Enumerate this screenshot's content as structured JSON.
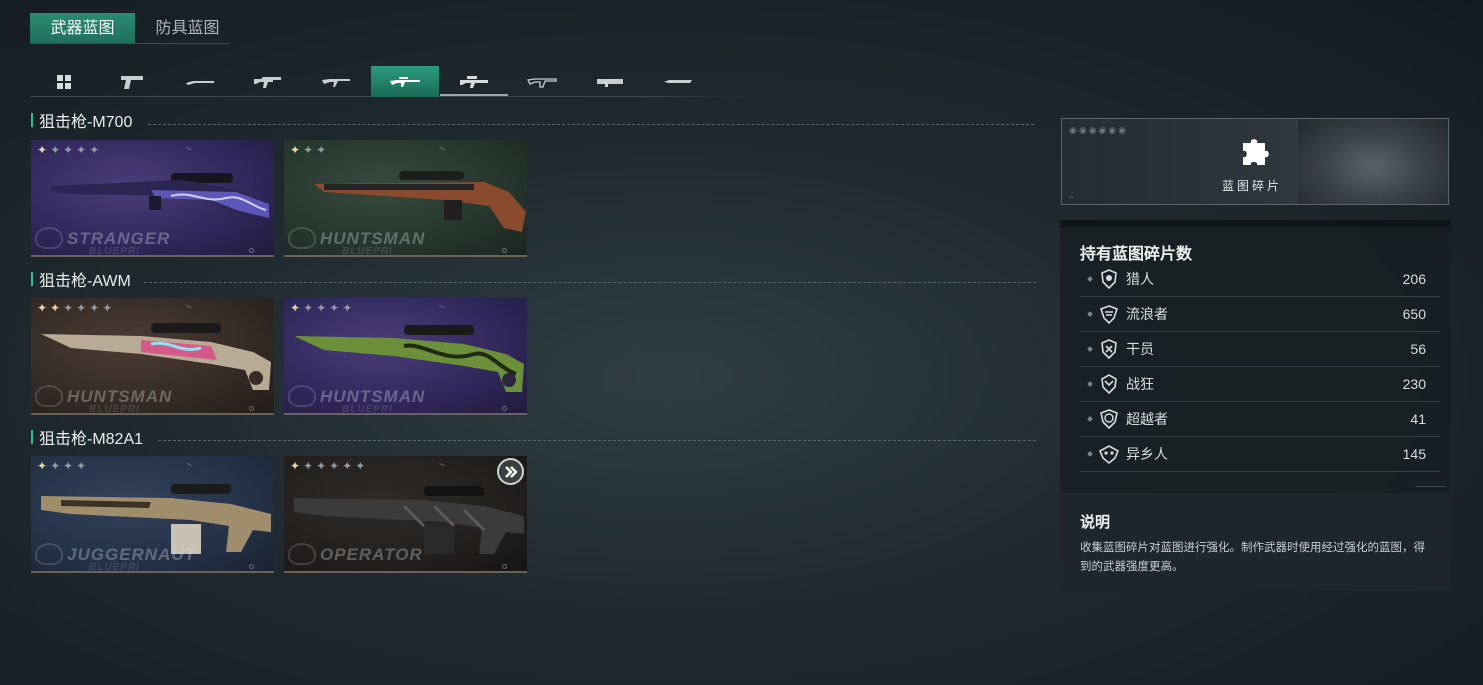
{
  "top_tabs": [
    {
      "label": "武器蓝图",
      "active": true
    },
    {
      "label": "防具蓝图",
      "active": false
    }
  ],
  "categories": [
    {
      "icon": "grid-icon",
      "active": false
    },
    {
      "icon": "pistol-icon",
      "active": false
    },
    {
      "icon": "shotgun-icon",
      "active": false
    },
    {
      "icon": "smg-icon",
      "active": false
    },
    {
      "icon": "assault-rifle-icon",
      "active": false
    },
    {
      "icon": "sniper-rifle-icon",
      "active": true
    },
    {
      "icon": "dmr-icon",
      "active": false
    },
    {
      "icon": "lmg-icon",
      "active": false
    },
    {
      "icon": "launcher-icon",
      "active": false
    },
    {
      "icon": "melee-icon",
      "active": false
    }
  ],
  "sections": [
    {
      "title": "狙击枪-M700",
      "cards": [
        {
          "brand": "STRANGER",
          "brand_sub": "BLUEPRI",
          "stars_lit": 1,
          "stars_total": 5,
          "theme": "purple",
          "locked": false
        },
        {
          "brand": "HUNTSMAN",
          "brand_sub": "BLUEPRI",
          "stars_lit": 1,
          "stars_total": 3,
          "theme": "green",
          "locked": false
        }
      ]
    },
    {
      "title": "狙击枪-AWM",
      "cards": [
        {
          "brand": "HUNTSMAN",
          "brand_sub": "BLUEPRI",
          "stars_lit": 2,
          "stars_total": 6,
          "theme": "brown",
          "locked": false
        },
        {
          "brand": "HUNTSMAN",
          "brand_sub": "BLUEPRI",
          "stars_lit": 1,
          "stars_total": 5,
          "theme": "purple",
          "locked": false
        }
      ]
    },
    {
      "title": "狙击枪-M82A1",
      "cards": [
        {
          "brand": "JUGGERNAUT",
          "brand_sub": "BLUEPRI",
          "stars_lit": 1,
          "stars_total": 4,
          "theme": "blue",
          "locked": false
        },
        {
          "brand": "OPERATOR",
          "brand_sub": "",
          "stars_lit": 1,
          "stars_total": 6,
          "theme": "dark",
          "locked": true
        }
      ]
    }
  ],
  "fragment_banner": {
    "label": "蓝图碎片",
    "icon": "puzzle-piece-icon"
  },
  "holding": {
    "title": "持有蓝图碎片数",
    "rows": [
      {
        "name": "猎人",
        "count": "206",
        "icon": "hunter-faction-icon"
      },
      {
        "name": "流浪者",
        "count": "650",
        "icon": "wanderer-faction-icon"
      },
      {
        "name": "干员",
        "count": "56",
        "icon": "operative-faction-icon"
      },
      {
        "name": "战狂",
        "count": "230",
        "icon": "berserker-faction-icon"
      },
      {
        "name": "超越者",
        "count": "41",
        "icon": "transcender-faction-icon"
      },
      {
        "name": "异乡人",
        "count": "145",
        "icon": "outlander-faction-icon"
      }
    ]
  },
  "description": {
    "title": "说明",
    "text": "收集蓝图碎片对蓝图进行强化。制作武器时使用经过强化的蓝图，得到的武器强度更高。"
  },
  "colors": {
    "accent": "#2a8c72",
    "star_lit": "#e8d7a3"
  }
}
